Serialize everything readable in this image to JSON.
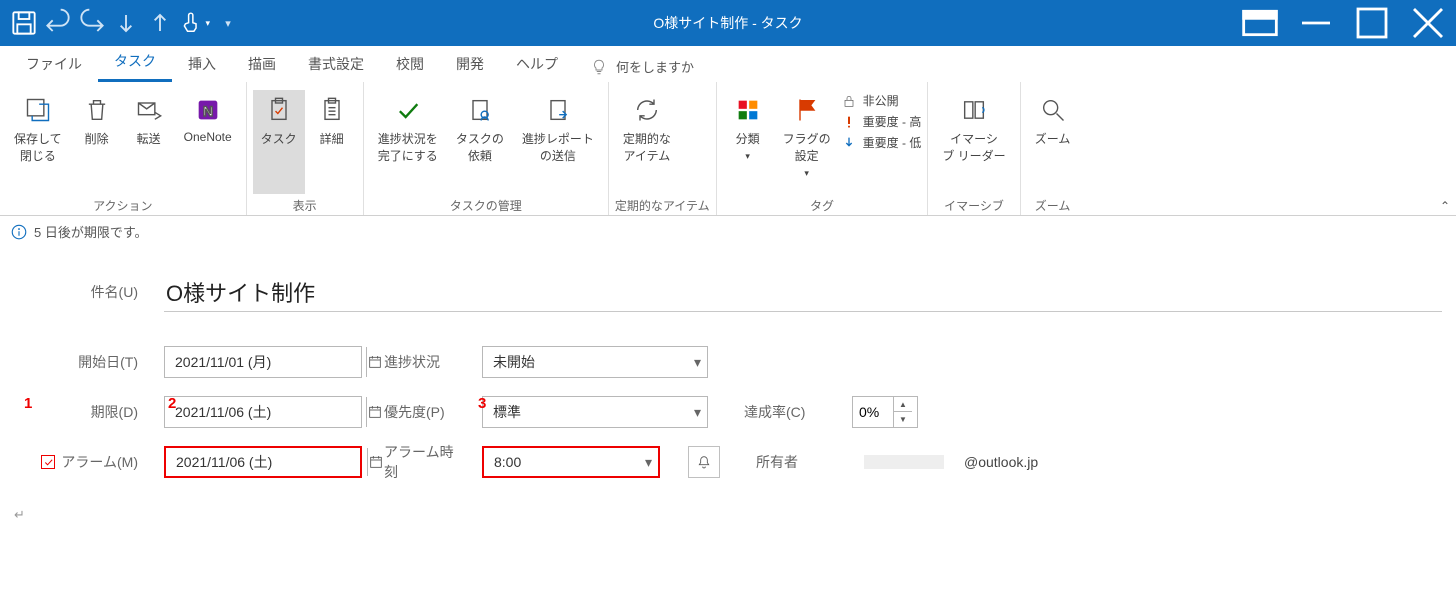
{
  "titlebar": {
    "title": "O様サイト制作 - タスク"
  },
  "tabs": {
    "file": "ファイル",
    "task": "タスク",
    "insert": "挿入",
    "draw": "描画",
    "format": "書式設定",
    "review": "校閲",
    "developer": "開発",
    "help": "ヘルプ",
    "tellme": "何をしますか"
  },
  "ribbon": {
    "actions": {
      "saveClose": "保存して\n閉じる",
      "delete": "削除",
      "forward": "転送",
      "onenote": "OneNote",
      "label": "アクション"
    },
    "show": {
      "task": "タスク",
      "details": "詳細",
      "label": "表示"
    },
    "manage": {
      "complete": "進捗状況を\n完了にする",
      "assign": "タスクの\n依頼",
      "sendStatus": "進捗レポート\nの送信",
      "label": "タスクの管理"
    },
    "recur": {
      "recurrence": "定期的な\nアイテム",
      "label": "定期的なアイテム"
    },
    "tags": {
      "categorize": "分類",
      "followup": "フラグの\n設定",
      "private": "非公開",
      "hiImp": "重要度 - 高",
      "loImp": "重要度 - 低",
      "label": "タグ"
    },
    "immersive": {
      "reader": "イマーシ\nブ リーダー",
      "label": "イマーシブ"
    },
    "zoom": {
      "zoom": "ズーム",
      "label": "ズーム"
    }
  },
  "infobar": "5 日後が期限です。",
  "labels": {
    "subject": "件名(U)",
    "start": "開始日(T)",
    "due": "期限(D)",
    "alarm": "アラーム(M)",
    "status": "進捗状況",
    "priority": "優先度(P)",
    "alarmTime": "アラーム時刻",
    "percent": "達成率(C)",
    "owner": "所有者"
  },
  "values": {
    "subject": "O様サイト制作",
    "startDate": "2021/11/01 (月)",
    "dueDate": "2021/11/06 (土)",
    "alarmDate": "2021/11/06 (土)",
    "status": "未開始",
    "priority": "標準",
    "alarmTime": "8:00",
    "percent": "0%",
    "ownerDomain": "@outlook.jp"
  },
  "annotations": {
    "n1": "1",
    "n2": "2",
    "n3": "3"
  }
}
